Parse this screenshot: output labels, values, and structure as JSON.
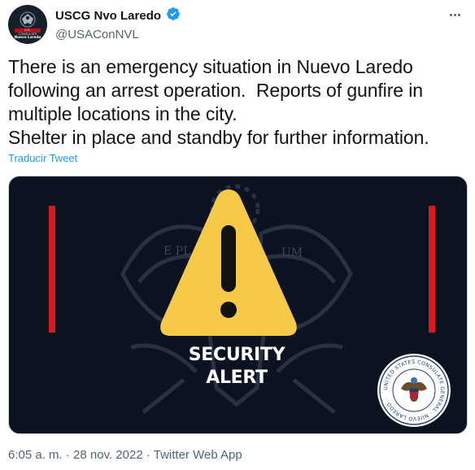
{
  "account": {
    "display_name": "USCG Nvo Laredo",
    "handle": "@USAConNVL",
    "avatar_banner": "U.S. CONSULATE",
    "avatar_subtitle": "Nuevo Laredo"
  },
  "tweet": {
    "text": "There is an emergency situation in Nuevo Laredo\nfollowing an arrest operation.  Reports of gunfire in\nmultiple locations in the city.\nShelter in place and standby for further information.",
    "translate_label": "Traducir Tweet"
  },
  "media": {
    "alert_line1": "SECURITY",
    "alert_line2": "ALERT",
    "seal_text": "UNITED STATES CONSULATE GENERAL · NUEVO LAREDO ·",
    "colors": {
      "background": "#0b1220",
      "warning_yellow": "#f7c948",
      "red_bar": "#d71920"
    }
  },
  "footer": {
    "time": "6:05 a. m.",
    "separator": " · ",
    "date": "28 nov. 2022",
    "app": "Twitter Web App"
  },
  "icons": {
    "verified": "verified-badge-icon",
    "more": "more-options-icon",
    "warning": "warning-triangle-icon"
  },
  "colors": {
    "link": "#1d9bf0",
    "secondary_text": "#536471",
    "primary_text": "#0f1419"
  }
}
